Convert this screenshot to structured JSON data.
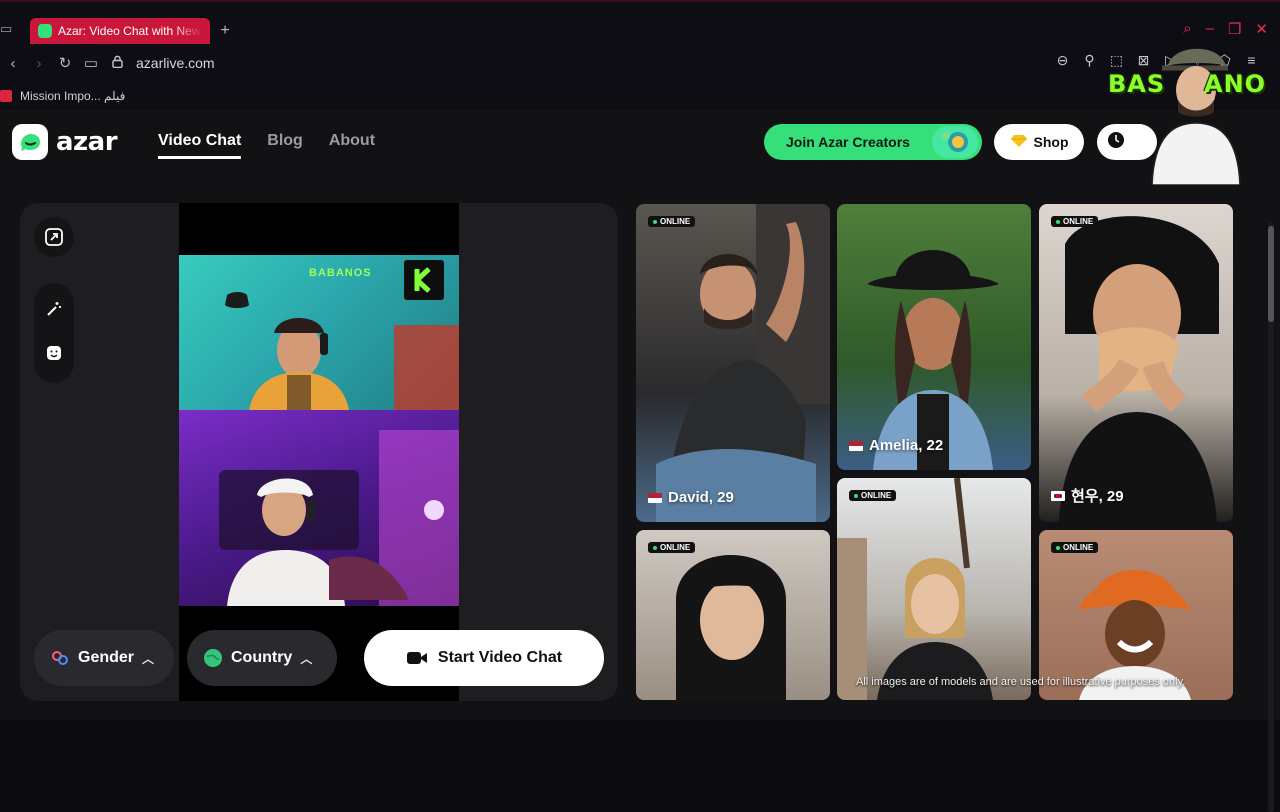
{
  "browser": {
    "tab_title": "Azar: Video Chat with New",
    "new_tab": "+",
    "url": "azarlive.com",
    "bookmark_label": "Mission Impo... فيلم",
    "accent": "#c8173a"
  },
  "watermark": {
    "text_left": "BAS",
    "text_right": "ANO"
  },
  "site": {
    "logo_text": "azar",
    "nav": [
      "Video Chat",
      "Blog",
      "About"
    ],
    "join_label": "Join Azar Creators",
    "shop_label": "Shop",
    "brand_green": "#35e07a"
  },
  "panel": {
    "cam_tag": "BABANOS",
    "gender_label": "Gender",
    "country_label": "Country",
    "start_label": "Start Video Chat"
  },
  "gallery": {
    "online_label": "ONLINE",
    "cards": [
      {
        "name": "David, 29"
      },
      {
        "name": "Amelia, 22"
      },
      {
        "name": "현우, 29"
      }
    ],
    "disclaimer": "All images are of models and are used for illustrative purposes only."
  }
}
